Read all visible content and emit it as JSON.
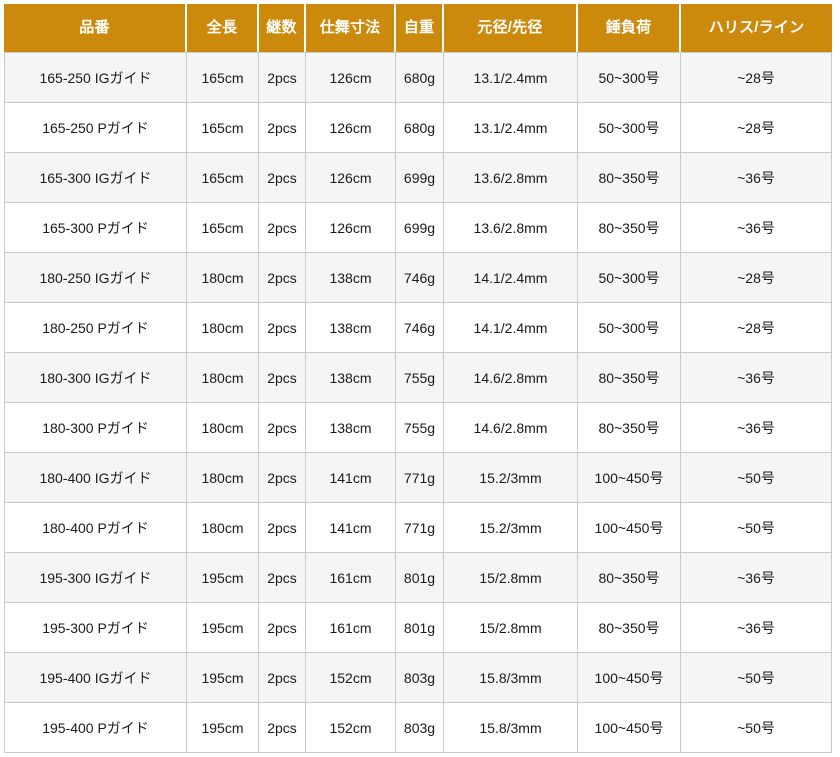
{
  "table": {
    "columns": [
      {
        "key": "model",
        "label": "品番"
      },
      {
        "key": "length",
        "label": "全長"
      },
      {
        "key": "pieces",
        "label": "継数"
      },
      {
        "key": "folded",
        "label": "仕舞寸法"
      },
      {
        "key": "weight",
        "label": "自重"
      },
      {
        "key": "diam",
        "label": "元径/先径"
      },
      {
        "key": "sinker",
        "label": "錘負荷"
      },
      {
        "key": "line",
        "label": "ハリス/ライン"
      }
    ],
    "rows": [
      {
        "model": "165-250 IGガイド",
        "length": "165cm",
        "pieces": "2pcs",
        "folded": "126cm",
        "weight": "680g",
        "diam": "13.1/2.4mm",
        "sinker": "50~300号",
        "line": "~28号"
      },
      {
        "model": "165-250 Pガイド",
        "length": "165cm",
        "pieces": "2pcs",
        "folded": "126cm",
        "weight": "680g",
        "diam": "13.1/2.4mm",
        "sinker": "50~300号",
        "line": "~28号"
      },
      {
        "model": "165-300 IGガイド",
        "length": "165cm",
        "pieces": "2pcs",
        "folded": "126cm",
        "weight": "699g",
        "diam": "13.6/2.8mm",
        "sinker": "80~350号",
        "line": "~36号"
      },
      {
        "model": "165-300 Pガイド",
        "length": "165cm",
        "pieces": "2pcs",
        "folded": "126cm",
        "weight": "699g",
        "diam": "13.6/2.8mm",
        "sinker": "80~350号",
        "line": "~36号"
      },
      {
        "model": "180-250 IGガイド",
        "length": "180cm",
        "pieces": "2pcs",
        "folded": "138cm",
        "weight": "746g",
        "diam": "14.1/2.4mm",
        "sinker": "50~300号",
        "line": "~28号"
      },
      {
        "model": "180-250 Pガイド",
        "length": "180cm",
        "pieces": "2pcs",
        "folded": "138cm",
        "weight": "746g",
        "diam": "14.1/2.4mm",
        "sinker": "50~300号",
        "line": "~28号"
      },
      {
        "model": "180-300 IGガイド",
        "length": "180cm",
        "pieces": "2pcs",
        "folded": "138cm",
        "weight": "755g",
        "diam": "14.6/2.8mm",
        "sinker": "80~350号",
        "line": "~36号"
      },
      {
        "model": "180-300 Pガイド",
        "length": "180cm",
        "pieces": "2pcs",
        "folded": "138cm",
        "weight": "755g",
        "diam": "14.6/2.8mm",
        "sinker": "80~350号",
        "line": "~36号"
      },
      {
        "model": "180-400 IGガイド",
        "length": "180cm",
        "pieces": "2pcs",
        "folded": "141cm",
        "weight": "771g",
        "diam": "15.2/3mm",
        "sinker": "100~450号",
        "line": "~50号"
      },
      {
        "model": "180-400 Pガイド",
        "length": "180cm",
        "pieces": "2pcs",
        "folded": "141cm",
        "weight": "771g",
        "diam": "15.2/3mm",
        "sinker": "100~450号",
        "line": "~50号"
      },
      {
        "model": "195-300 IGガイド",
        "length": "195cm",
        "pieces": "2pcs",
        "folded": "161cm",
        "weight": "801g",
        "diam": "15/2.8mm",
        "sinker": "80~350号",
        "line": "~36号"
      },
      {
        "model": "195-300 Pガイド",
        "length": "195cm",
        "pieces": "2pcs",
        "folded": "161cm",
        "weight": "801g",
        "diam": "15/2.8mm",
        "sinker": "80~350号",
        "line": "~36号"
      },
      {
        "model": "195-400 IGガイド",
        "length": "195cm",
        "pieces": "2pcs",
        "folded": "152cm",
        "weight": "803g",
        "diam": "15.8/3mm",
        "sinker": "100~450号",
        "line": "~50号"
      },
      {
        "model": "195-400 Pガイド",
        "length": "195cm",
        "pieces": "2pcs",
        "folded": "152cm",
        "weight": "803g",
        "diam": "15.8/3mm",
        "sinker": "100~450号",
        "line": "~50号"
      }
    ]
  },
  "colors": {
    "header_background": "#cc8a0d",
    "header_text": "#ffffff",
    "row_odd_background": "#f5f5f5",
    "row_even_background": "#ffffff",
    "border": "#c9c9c9",
    "body_text": "#1a1a1a"
  }
}
